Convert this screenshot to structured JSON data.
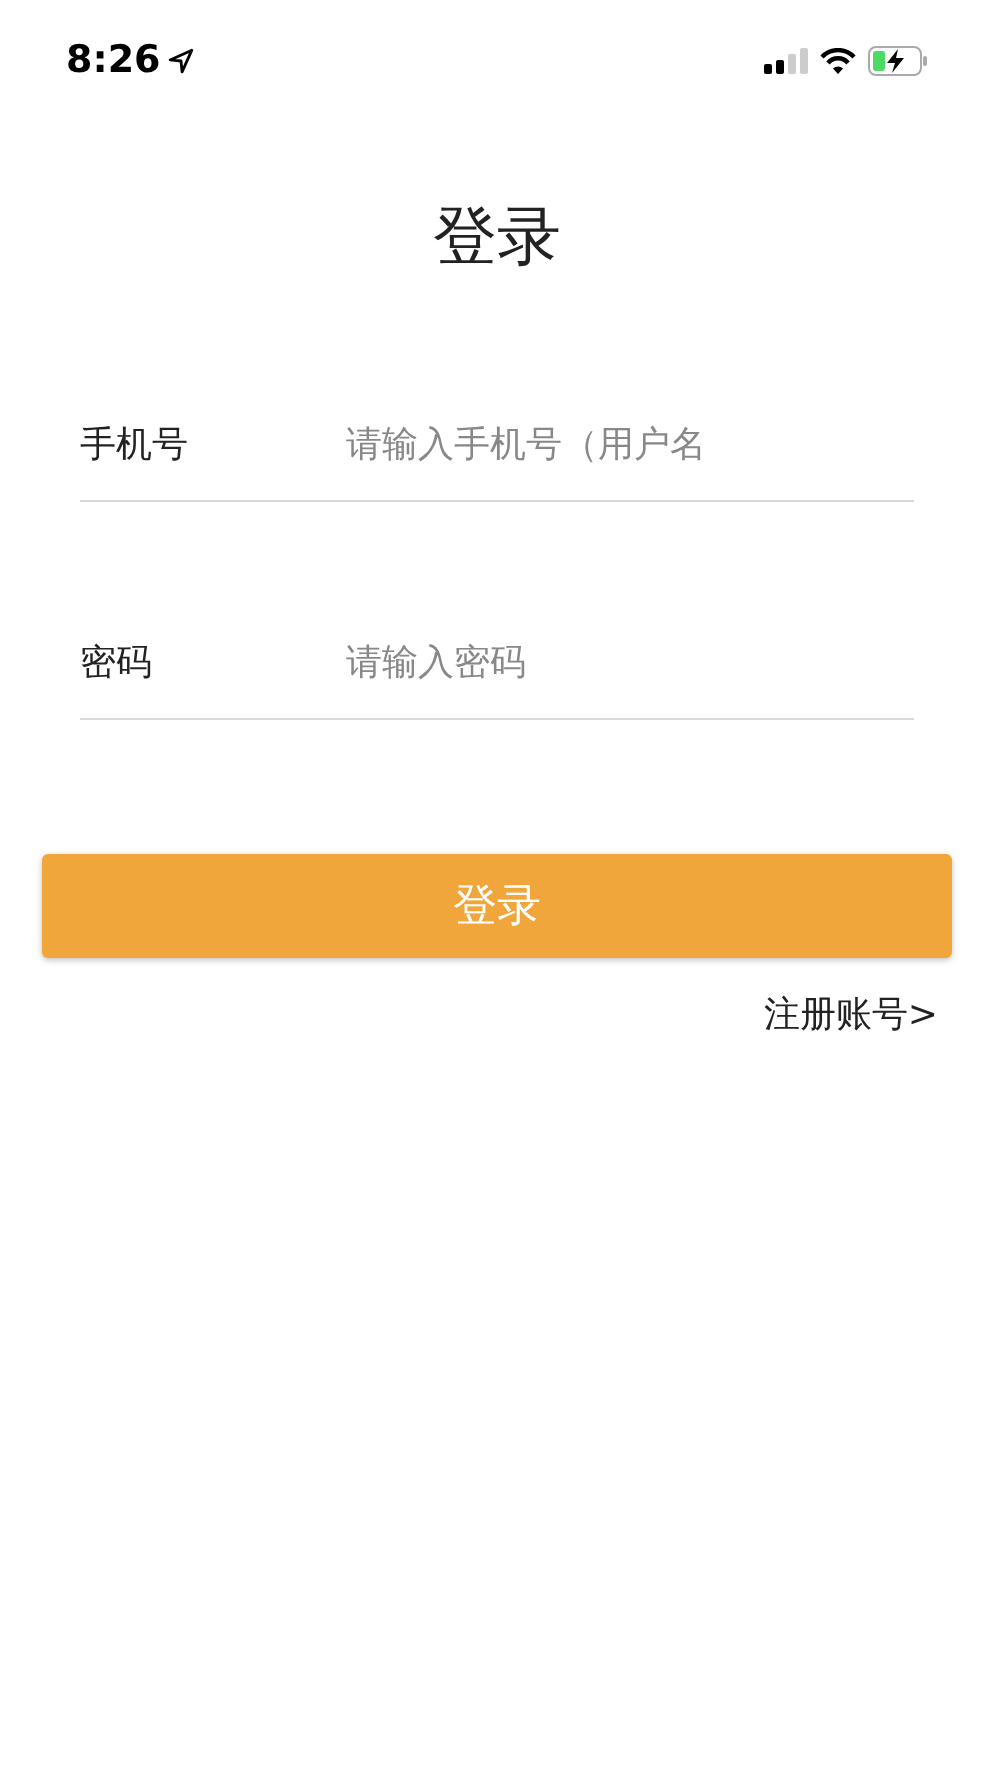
{
  "status_bar": {
    "time": "8:26"
  },
  "title": "登录",
  "fields": [
    {
      "label": "手机号",
      "placeholder": "请输入手机号（用户名"
    },
    {
      "label": "密码",
      "placeholder": "请输入密码"
    }
  ],
  "login_button": "登录",
  "register_link": "注册账号>"
}
